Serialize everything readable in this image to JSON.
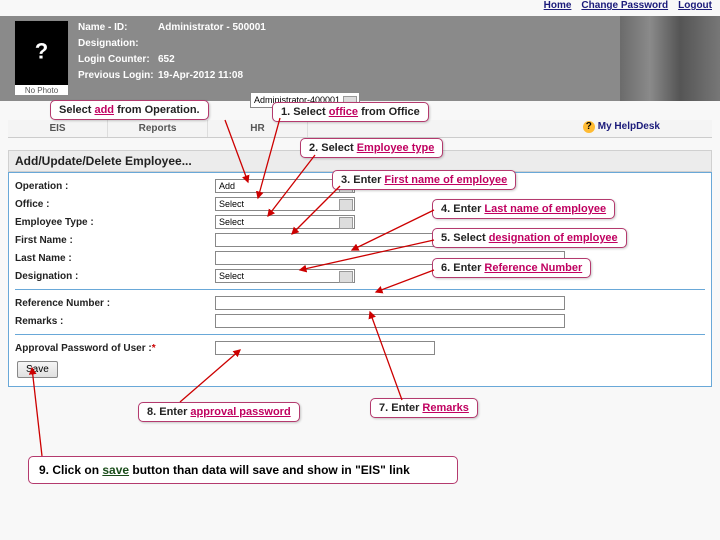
{
  "topLinks": {
    "home": "Home",
    "changePw": "Change Password",
    "logout": "Logout"
  },
  "photoCaption": "No Photo",
  "meta": {
    "nameLabel": "Name - ID:",
    "nameValue": "Administrator - 500001",
    "desigLabel": "Designation:",
    "desigValue": "",
    "counterLabel": "Login Counter:",
    "counterValue": "652",
    "prevLabel": "Previous Login:",
    "prevValue": "19-Apr-2012 11:08",
    "officeSelector": "Administrator-400001"
  },
  "tabs": [
    "EIS",
    "Reports",
    "HR"
  ],
  "helpdesk": "My HelpDesk",
  "pageTitle": "Add/Update/Delete Employee...",
  "form": {
    "operation": {
      "label": "Operation :",
      "value": "Add"
    },
    "office": {
      "label": "Office :",
      "value": "Select"
    },
    "emptype": {
      "label": "Employee Type :",
      "value": "Select"
    },
    "first": {
      "label": "First Name :",
      "value": ""
    },
    "last": {
      "label": "Last Name :",
      "value": ""
    },
    "desig": {
      "label": "Designation :",
      "value": "Select"
    },
    "ref": {
      "label": "Reference Number :",
      "value": ""
    },
    "remarks": {
      "label": "Remarks :",
      "value": ""
    },
    "approval": {
      "label": "Approval Password of User :",
      "value": ""
    },
    "star": "*",
    "save": "Save"
  },
  "callouts": {
    "c0a": "Select ",
    "c0b": "add",
    "c0c": " from Operation.",
    "c1a": "1. Select ",
    "c1b": "office",
    "c1c": " from Office",
    "c2a": "2. Select ",
    "c2b": "Employee type",
    "c3a": "3. Enter ",
    "c3b": "First name of employee",
    "c4a": "4. Enter ",
    "c4b": "Last name of employee",
    "c5a": "5. Select ",
    "c5b": "designation of employee",
    "c6a": "6. Enter ",
    "c6b": "Reference Number",
    "c7a": "7. Enter ",
    "c7b": "Remarks",
    "c8a": "8. Enter ",
    "c8b": "approval password",
    "c9a": "9. Click on ",
    "c9b": "save",
    "c9c": " button than data will save and show in \"EIS\" link"
  }
}
